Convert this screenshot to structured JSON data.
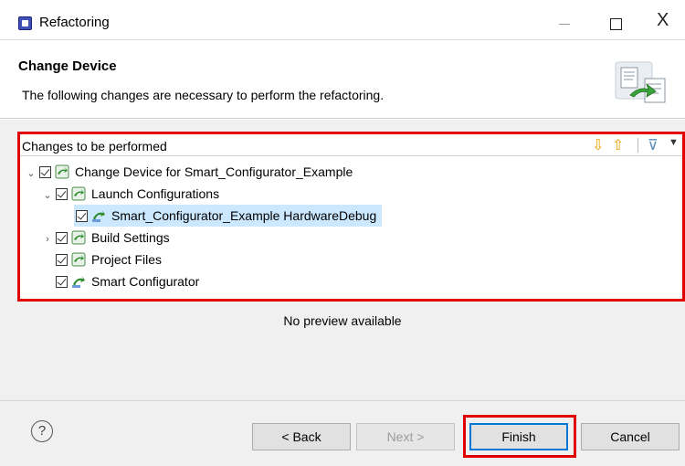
{
  "window": {
    "title": "Refactoring",
    "close_glyph": "X"
  },
  "header": {
    "title": "Change Device",
    "description": "The following changes are necessary to perform the refactoring."
  },
  "changes": {
    "title": "Changes to be performed",
    "tree": [
      {
        "label": "Change Device for Smart_Configurator_Example",
        "checked": true,
        "expanded": true,
        "icon": "refactor-change-icon"
      },
      {
        "label": "Launch Configurations",
        "checked": true,
        "expanded": true,
        "icon": "refactor-change-icon"
      },
      {
        "label": "Smart_Configurator_Example HardwareDebug",
        "checked": true,
        "selected": true,
        "icon": "launch-change-icon"
      },
      {
        "label": "Build Settings",
        "checked": true,
        "expanded": false,
        "icon": "refactor-change-icon"
      },
      {
        "label": "Project Files",
        "checked": true,
        "icon": "refactor-change-icon"
      },
      {
        "label": "Smart Configurator",
        "checked": true,
        "icon": "launch-change-icon"
      }
    ]
  },
  "preview": {
    "text": "No preview available"
  },
  "footer": {
    "help_glyph": "?",
    "back_label": "< Back",
    "next_label": "Next >",
    "finish_label": "Finish",
    "cancel_label": "Cancel"
  },
  "colors": {
    "highlight": "#e00000",
    "selection": "#cce8ff",
    "primary_border": "#0078d7"
  }
}
